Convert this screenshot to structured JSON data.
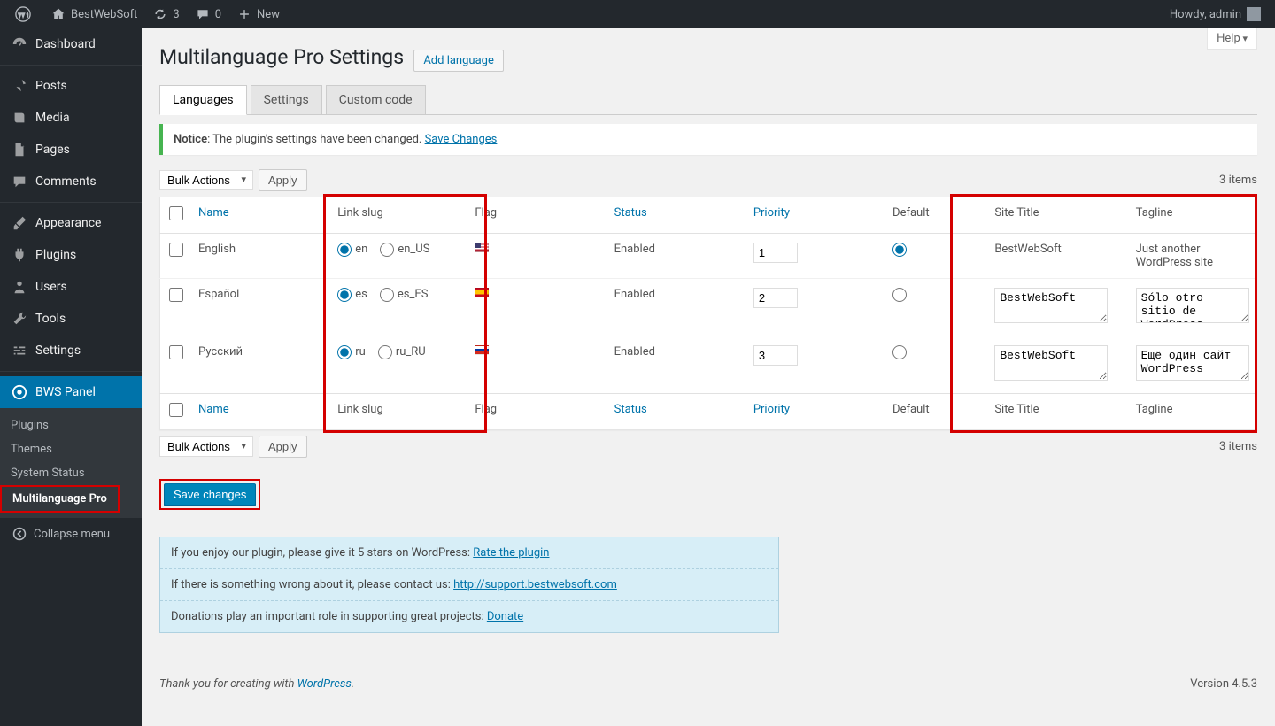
{
  "adminbar": {
    "site_name": "BestWebSoft",
    "updates_count": "3",
    "comments_count": "0",
    "new_label": "New",
    "howdy": "Howdy, admin"
  },
  "sidebar": {
    "items": [
      {
        "label": "Dashboard"
      },
      {
        "label": "Posts"
      },
      {
        "label": "Media"
      },
      {
        "label": "Pages"
      },
      {
        "label": "Comments"
      },
      {
        "label": "Appearance"
      },
      {
        "label": "Plugins"
      },
      {
        "label": "Users"
      },
      {
        "label": "Tools"
      },
      {
        "label": "Settings"
      },
      {
        "label": "BWS Panel"
      }
    ],
    "sub": [
      {
        "label": "Plugins"
      },
      {
        "label": "Themes"
      },
      {
        "label": "System Status"
      },
      {
        "label": "Multilanguage Pro"
      }
    ],
    "collapse": "Collapse menu"
  },
  "page": {
    "title": "Multilanguage Pro Settings",
    "add_language": "Add language",
    "help": "Help"
  },
  "tabs": {
    "languages": "Languages",
    "settings": "Settings",
    "custom_code": "Custom code"
  },
  "notice": {
    "prefix": "Notice",
    "text": ": The plugin's settings have been changed. ",
    "link": "Save Changes"
  },
  "bulk": {
    "label": "Bulk Actions",
    "apply": "Apply",
    "items": "3 items"
  },
  "cols": {
    "name": "Name",
    "slug": "Link slug",
    "flag": "Flag",
    "status": "Status",
    "priority": "Priority",
    "default": "Default",
    "site_title": "Site Title",
    "tagline": "Tagline"
  },
  "rows": [
    {
      "name": "English",
      "slug1": "en",
      "slug2": "en_US",
      "flagcls": "flag-us",
      "status": "Enabled",
      "priority": "1",
      "is_default": true,
      "site_title": "BestWebSoft",
      "tagline": "Just another WordPress site",
      "editable": false
    },
    {
      "name": "Español",
      "slug1": "es",
      "slug2": "es_ES",
      "flagcls": "flag-es",
      "status": "Enabled",
      "priority": "2",
      "is_default": false,
      "site_title": "BestWebSoft",
      "tagline": "Sólo otro sitio de WordPress",
      "editable": true
    },
    {
      "name": "Русский",
      "slug1": "ru",
      "slug2": "ru_RU",
      "flagcls": "flag-ru",
      "status": "Enabled",
      "priority": "3",
      "is_default": false,
      "site_title": "BestWebSoft",
      "tagline": "Ещё один сайт WordPress",
      "editable": true
    }
  ],
  "save_changes": "Save changes",
  "infobox": {
    "l1a": "If you enjoy our plugin, please give it 5 stars on WordPress: ",
    "l1b": "Rate the plugin",
    "l2a": "If there is something wrong about it, please contact us: ",
    "l2b": "http://support.bestwebsoft.com",
    "l3a": "Donations play an important role in supporting great projects: ",
    "l3b": "Donate"
  },
  "footer": {
    "left_a": "Thank you for creating with ",
    "left_b": "WordPress",
    "right": "Version 4.5.3"
  }
}
